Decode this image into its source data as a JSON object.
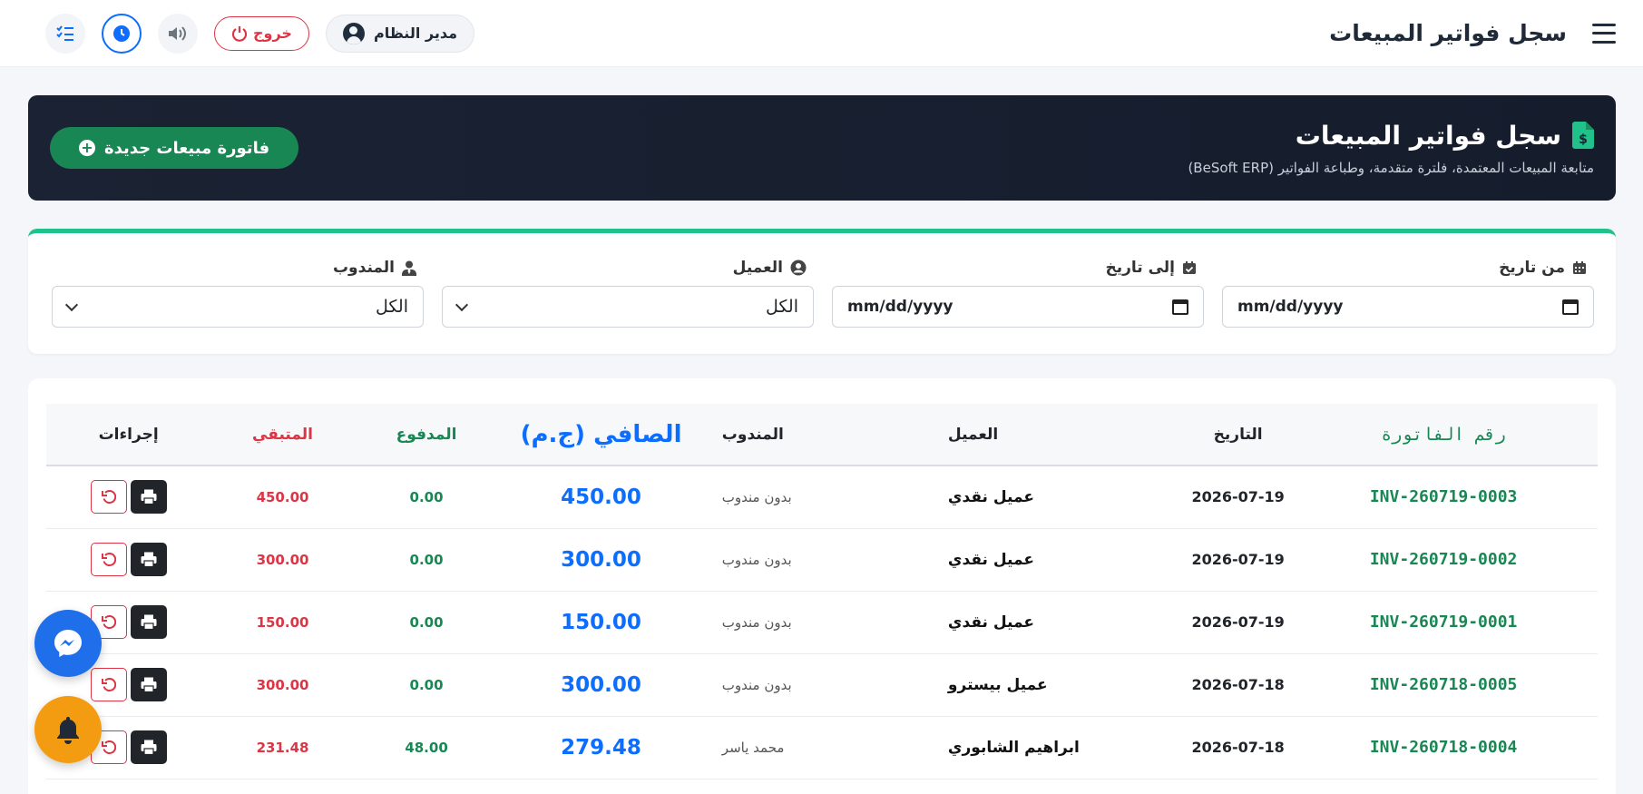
{
  "topbar": {
    "title": "سجل فواتير المبيعات",
    "user_label": "مدير النظام",
    "logout_label": "خروج"
  },
  "banner": {
    "title": "سجل فواتير المبيعات",
    "subtitle": "متابعة المبيعات المعتمدة، فلترة متقدمة، وطباعة الفواتير (BeSoft ERP)",
    "new_button_label": "فاتورة مبيعات جديدة"
  },
  "filters": {
    "from_date": {
      "label": "من تاريخ",
      "value": "mm/dd/yyyy"
    },
    "to_date": {
      "label": "إلى تاريخ",
      "value": "mm/dd/yyyy"
    },
    "client": {
      "label": "العميل",
      "value": "الكل"
    },
    "rep": {
      "label": "المندوب",
      "value": "الكل"
    }
  },
  "table": {
    "headers": {
      "invoice_no": "رقم الفاتورة",
      "date": "التاريخ",
      "client": "العميل",
      "rep": "المندوب",
      "net": "الصافي (ج.م)",
      "paid": "المدفوع",
      "remaining": "المتبقي",
      "actions": "إجراءات"
    },
    "rows": [
      {
        "invoice_no": "INV-260719-0003",
        "date": "2026-07-19",
        "client": "عميل نقدي",
        "rep": "بدون مندوب",
        "net": "450.00",
        "paid": "0.00",
        "remaining": "450.00"
      },
      {
        "invoice_no": "INV-260719-0002",
        "date": "2026-07-19",
        "client": "عميل نقدي",
        "rep": "بدون مندوب",
        "net": "300.00",
        "paid": "0.00",
        "remaining": "300.00"
      },
      {
        "invoice_no": "INV-260719-0001",
        "date": "2026-07-19",
        "client": "عميل نقدي",
        "rep": "بدون مندوب",
        "net": "150.00",
        "paid": "0.00",
        "remaining": "150.00"
      },
      {
        "invoice_no": "INV-260718-0005",
        "date": "2026-07-18",
        "client": "عميل بيسترو",
        "rep": "بدون مندوب",
        "net": "300.00",
        "paid": "0.00",
        "remaining": "300.00"
      },
      {
        "invoice_no": "INV-260718-0004",
        "date": "2026-07-18",
        "client": "ابراهيم الشابوري",
        "rep": "محمد ياسر",
        "net": "279.48",
        "paid": "48.00",
        "remaining": "231.48"
      }
    ]
  },
  "colors": {
    "accent_green": "#198754",
    "accent_blue": "#0d6efd",
    "danger_red": "#dc3545",
    "banner_dark": "#1a2233"
  },
  "icons": [
    "menu-icon",
    "user-icon",
    "power-icon",
    "speaker-icon",
    "clock-icon",
    "checklist-icon",
    "invoice-dollar-icon",
    "plus-circle-icon",
    "calendar-icon",
    "calendar-check-icon",
    "user-circle-icon",
    "user-tie-icon",
    "chevron-down-icon",
    "print-icon",
    "undo-icon",
    "messenger-icon",
    "bell-icon"
  ]
}
